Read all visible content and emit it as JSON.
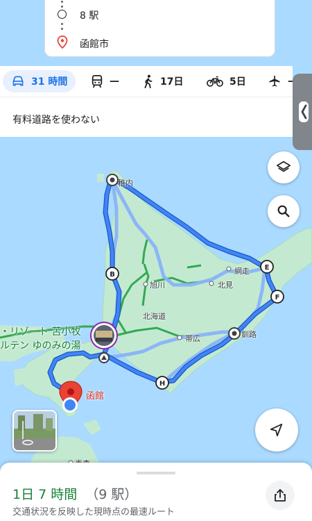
{
  "route_card": {
    "stops": [
      {
        "label": "8 駅",
        "type": "waypoint"
      },
      {
        "label": "函館市",
        "type": "destination"
      }
    ]
  },
  "modes": [
    {
      "id": "drive",
      "icon": "car-icon",
      "label": "31 時間",
      "active": true
    },
    {
      "id": "transit",
      "icon": "train-icon",
      "label": "—",
      "active": false
    },
    {
      "id": "walk",
      "icon": "walking-icon",
      "label": "17日",
      "active": false
    },
    {
      "id": "bike",
      "icon": "bicycle-icon",
      "label": "5日",
      "active": false
    },
    {
      "id": "flight",
      "icon": "airplane-icon",
      "label": "—",
      "active": false
    }
  ],
  "options": {
    "avoid_tolls": "有料道路を使わない"
  },
  "map": {
    "places": {
      "wakkanai": "稚内",
      "asahikawa": "旭川",
      "abashiri": "網走",
      "kitami": "北見",
      "hokkaido": "北海道",
      "obihiro": "帯広",
      "kushiro": "釧路",
      "aomori": "青森"
    },
    "markers": {
      "b": "B",
      "e": "E",
      "f": "F",
      "h": "H"
    },
    "hotel": {
      "line1": "・リゾート 苫小牧",
      "line2": "ルテン ゆのみの湯"
    },
    "destination": "函館",
    "colors": {
      "route": "#4285f4",
      "route_outline": "#1a56c8",
      "alt_route": "#8ab4f8",
      "highway": "#34a853",
      "land": "#c3ead1",
      "sea": "#aadaff",
      "dest_pin": "#ea4335"
    }
  },
  "bottom": {
    "duration": "1日 7 時間",
    "stations": "（9 駅）",
    "subtitle": "交通状況を反映した現時点の最速ルート"
  }
}
